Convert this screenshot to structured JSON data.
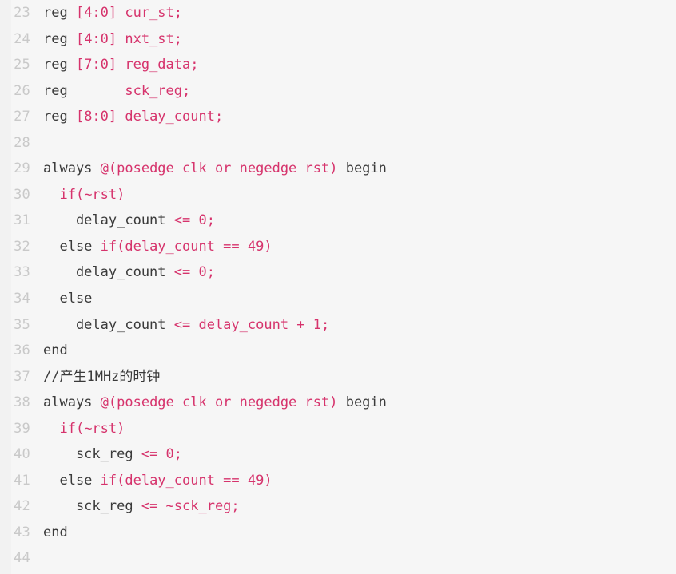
{
  "editor": {
    "language": "Verilog",
    "background_color": "#f6f6f6",
    "gutter_color": "#f2f2f2",
    "line_number_color": "#c9c9c9",
    "default_text_color": "#3a3a3a",
    "accent_text_color": "#d6336c",
    "first_line_number": 23,
    "last_line_number": 44
  },
  "lines": [
    {
      "number": "23",
      "text": "reg [4:0] cur_st;",
      "tokens": [
        {
          "t": "reg ",
          "c": "plain"
        },
        {
          "t": "[4:0] cur_st;",
          "c": "accent"
        }
      ]
    },
    {
      "number": "24",
      "text": "reg [4:0] nxt_st;",
      "tokens": [
        {
          "t": "reg ",
          "c": "plain"
        },
        {
          "t": "[4:0] nxt_st;",
          "c": "accent"
        }
      ]
    },
    {
      "number": "25",
      "text": "reg [7:0] reg_data;",
      "tokens": [
        {
          "t": "reg ",
          "c": "plain"
        },
        {
          "t": "[7:0] reg_data;",
          "c": "accent"
        }
      ]
    },
    {
      "number": "26",
      "text": "reg       sck_reg;",
      "tokens": [
        {
          "t": "reg       ",
          "c": "plain"
        },
        {
          "t": "sck_reg;",
          "c": "accent"
        }
      ]
    },
    {
      "number": "27",
      "text": "reg [8:0] delay_count;",
      "tokens": [
        {
          "t": "reg ",
          "c": "plain"
        },
        {
          "t": "[8:0] delay_count;",
          "c": "accent"
        }
      ]
    },
    {
      "number": "28",
      "text": "",
      "tokens": []
    },
    {
      "number": "29",
      "text": "always @(posedge clk or negedge rst) begin",
      "tokens": [
        {
          "t": "always ",
          "c": "plain"
        },
        {
          "t": "@(posedge clk or negedge rst)",
          "c": "accent"
        },
        {
          "t": " begin",
          "c": "plain"
        }
      ]
    },
    {
      "number": "30",
      "text": "  if(~rst)",
      "tokens": [
        {
          "t": "  ",
          "c": "plain"
        },
        {
          "t": "if(~rst)",
          "c": "accent"
        }
      ]
    },
    {
      "number": "31",
      "text": "    delay_count <= 0;",
      "tokens": [
        {
          "t": "    delay_count ",
          "c": "plain"
        },
        {
          "t": "<= 0;",
          "c": "accent"
        }
      ]
    },
    {
      "number": "32",
      "text": "  else if(delay_count == 49)",
      "tokens": [
        {
          "t": "  else ",
          "c": "plain"
        },
        {
          "t": "if(delay_count == 49)",
          "c": "accent"
        }
      ]
    },
    {
      "number": "33",
      "text": "    delay_count <= 0;",
      "tokens": [
        {
          "t": "    delay_count ",
          "c": "plain"
        },
        {
          "t": "<= 0;",
          "c": "accent"
        }
      ]
    },
    {
      "number": "34",
      "text": "  else",
      "tokens": [
        {
          "t": "  else",
          "c": "plain"
        }
      ]
    },
    {
      "number": "35",
      "text": "    delay_count <= delay_count + 1;",
      "tokens": [
        {
          "t": "    delay_count ",
          "c": "plain"
        },
        {
          "t": "<= delay_count + 1;",
          "c": "accent"
        }
      ]
    },
    {
      "number": "36",
      "text": "end",
      "tokens": [
        {
          "t": "end",
          "c": "plain"
        }
      ]
    },
    {
      "number": "37",
      "text": "//产生1MHz的时钟",
      "tokens": [
        {
          "t": "//产生1MHz的时钟",
          "c": "comment"
        }
      ]
    },
    {
      "number": "38",
      "text": "always @(posedge clk or negedge rst) begin",
      "tokens": [
        {
          "t": "always ",
          "c": "plain"
        },
        {
          "t": "@(posedge clk or negedge rst)",
          "c": "accent"
        },
        {
          "t": " begin",
          "c": "plain"
        }
      ]
    },
    {
      "number": "39",
      "text": "  if(~rst)",
      "tokens": [
        {
          "t": "  ",
          "c": "plain"
        },
        {
          "t": "if(~rst)",
          "c": "accent"
        }
      ]
    },
    {
      "number": "40",
      "text": "    sck_reg <= 0;",
      "tokens": [
        {
          "t": "    sck_reg ",
          "c": "plain"
        },
        {
          "t": "<= 0;",
          "c": "accent"
        }
      ]
    },
    {
      "number": "41",
      "text": "  else if(delay_count == 49)",
      "tokens": [
        {
          "t": "  else ",
          "c": "plain"
        },
        {
          "t": "if(delay_count == 49)",
          "c": "accent"
        }
      ]
    },
    {
      "number": "42",
      "text": "    sck_reg <= ~sck_reg;",
      "tokens": [
        {
          "t": "    sck_reg ",
          "c": "plain"
        },
        {
          "t": "<= ~sck_reg;",
          "c": "accent"
        }
      ]
    },
    {
      "number": "43",
      "text": "end",
      "tokens": [
        {
          "t": "end",
          "c": "plain"
        }
      ]
    },
    {
      "number": "44",
      "text": "",
      "tokens": []
    }
  ]
}
